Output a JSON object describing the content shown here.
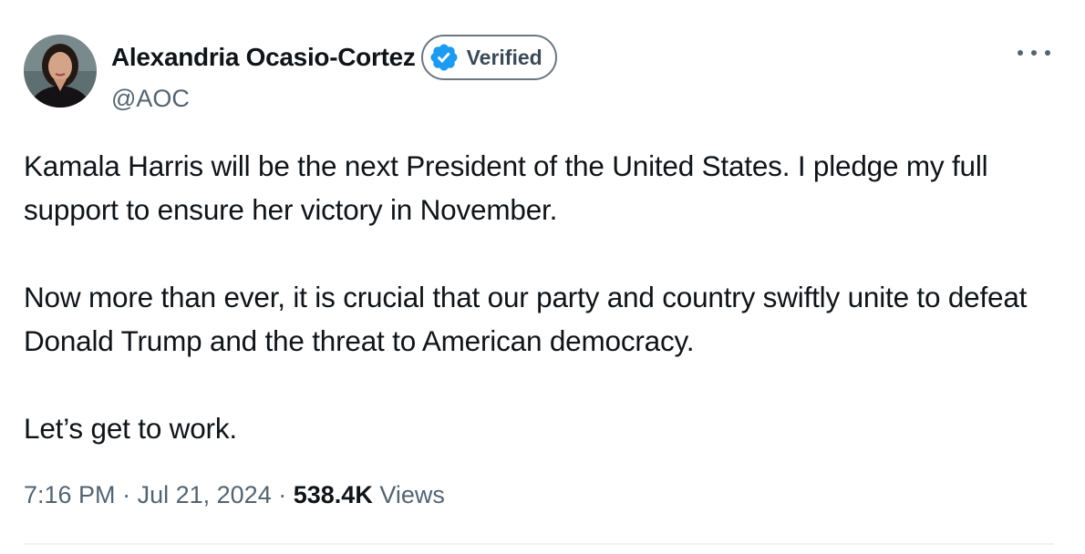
{
  "author": {
    "display_name": "Alexandria Ocasio-Cortez",
    "handle": "@AOC",
    "verified_label": "Verified",
    "avatar_icon": "profile-photo",
    "badge_icon": "verified-check-badge"
  },
  "tweet": {
    "paragraphs": [
      "Kamala Harris will be the next President of the United States. I pledge my full support to ensure her victory in November.",
      "Now more than ever, it is crucial that our party and country swiftly unite to defeat Donald Trump and the threat to American democracy.",
      "Let’s get to work."
    ]
  },
  "meta": {
    "time": "7:16 PM",
    "separator": "·",
    "date": "Jul 21, 2024",
    "views_count": "538.4K",
    "views_label": "Views"
  },
  "colors": {
    "verified_blue": "#1d9bf0",
    "text_primary": "#0f1419",
    "text_secondary": "#536471"
  },
  "icons": {
    "more": "more-horizontal-icon"
  }
}
